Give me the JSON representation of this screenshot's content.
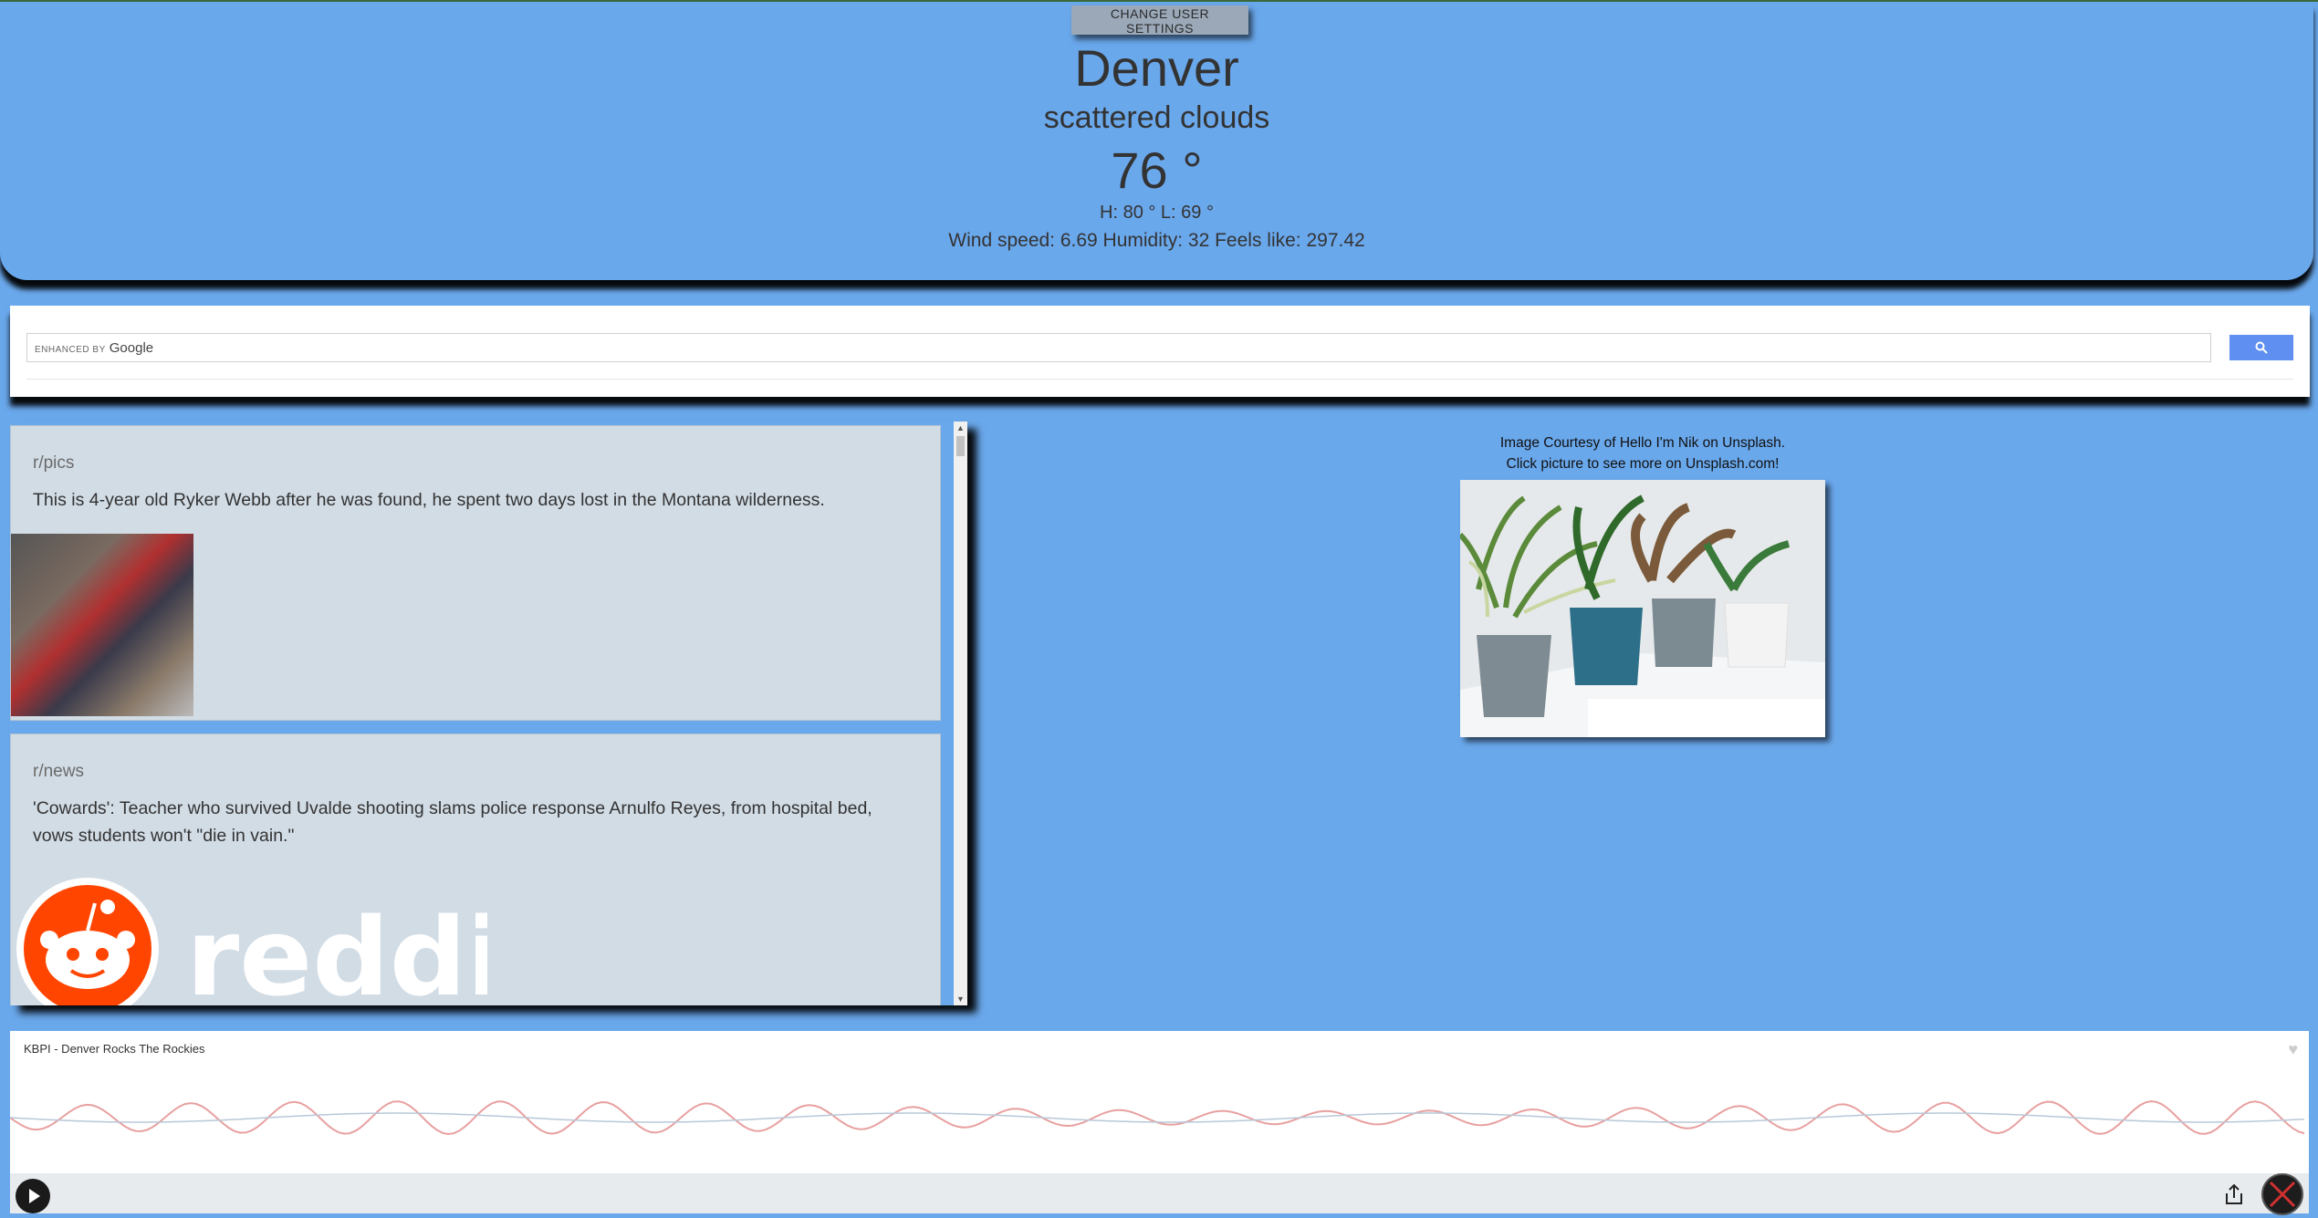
{
  "settings": {
    "button_label": "CHANGE USER SETTINGS"
  },
  "weather": {
    "city": "Denver",
    "description": "scattered clouds",
    "temperature": "76 °",
    "high_low": "H: 80 ° L: 69 °",
    "details": "Wind speed: 6.69 Humidity: 32 Feels like: 297.42"
  },
  "search": {
    "enhanced_label": "ENHANCED BY",
    "brand": "Google",
    "placeholder": ""
  },
  "feed": {
    "posts": [
      {
        "subreddit": "r/pics",
        "title": "This is 4-year old Ryker Webb after he was found, he spent two days lost in the Montana wilderness."
      },
      {
        "subreddit": "r/news",
        "title": "'Cowards': Teacher who survived Uvalde shooting slams police response Arnulfo Reyes, from hospital bed, vows students won't \"die in vain.\"",
        "logo_text": "reddit"
      }
    ]
  },
  "image": {
    "caption_line1": "Image Courtesy of Hello I'm Nik on Unsplash.",
    "caption_line2": "Click picture to see more on Unsplash.com!"
  },
  "player": {
    "station": "KBPI - Denver Rocks The Rockies"
  },
  "colors": {
    "background": "#6aa8ec",
    "card": "#d2dce5",
    "reddit_orange": "#ff4500",
    "search_button": "#5f8ff0"
  }
}
